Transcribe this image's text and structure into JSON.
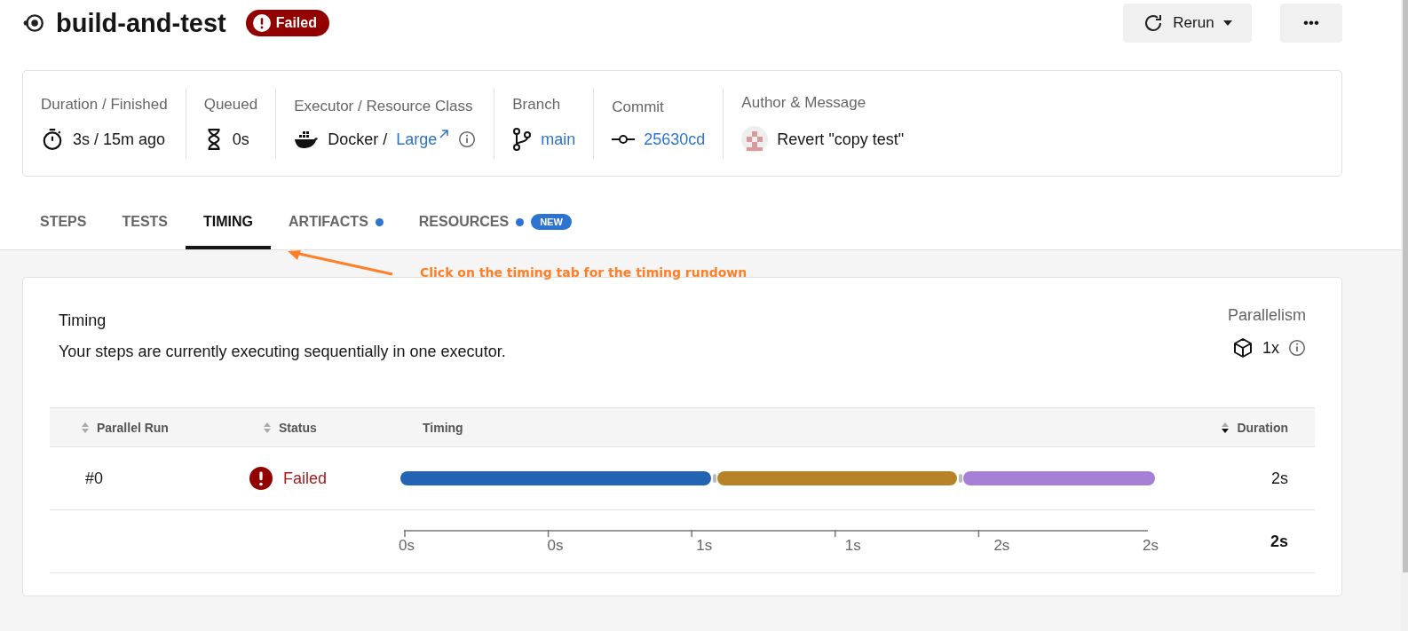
{
  "header": {
    "title": "build-and-test",
    "status": "Failed",
    "buttons": [
      {
        "kind": "rerun",
        "label": "Rerun"
      },
      {
        "kind": "more",
        "label": "•••"
      }
    ]
  },
  "info": [
    {
      "kind": "duration",
      "label": "Duration / Finished",
      "value": "3s / 15m ago"
    },
    {
      "kind": "queued",
      "label": "Queued",
      "value": "0s"
    },
    {
      "kind": "executor",
      "label": "Executor / Resource Class",
      "value": "Docker /",
      "link": "Large"
    },
    {
      "kind": "branch",
      "label": "Branch",
      "link": "main"
    },
    {
      "kind": "commit",
      "label": "Commit",
      "link": "25630cd"
    },
    {
      "kind": "author",
      "label": "Author & Message",
      "value": "Revert \"copy test\""
    }
  ],
  "tabs": [
    {
      "label": "STEPS",
      "selected": false,
      "dot": false
    },
    {
      "label": "TESTS",
      "selected": false,
      "dot": false
    },
    {
      "label": "TIMING",
      "selected": true,
      "dot": false
    },
    {
      "label": "ARTIFACTS",
      "selected": false,
      "dot": true
    },
    {
      "label": "RESOURCES",
      "selected": false,
      "dot": true,
      "badge": "NEW"
    }
  ],
  "annotation": {
    "text": "Click on the timing tab for the timing rundown"
  },
  "timing": {
    "title": "Timing",
    "description": "Your steps are currently executing sequentially in one executor.",
    "parallelism_label": "Parallelism",
    "parallelism_value": "1x",
    "columns": [
      {
        "label": "Parallel Run",
        "sorted": false
      },
      {
        "label": "Status",
        "sorted": false
      },
      {
        "label": "Timing"
      },
      {
        "label": "Duration",
        "sorted": true
      }
    ],
    "rows": [
      {
        "run": "#0",
        "status": "Failed",
        "duration": "2s"
      }
    ],
    "axis_ticks": [
      "0s",
      "0s",
      "1s",
      "1s",
      "2s",
      "2s"
    ],
    "total": "2s"
  }
}
